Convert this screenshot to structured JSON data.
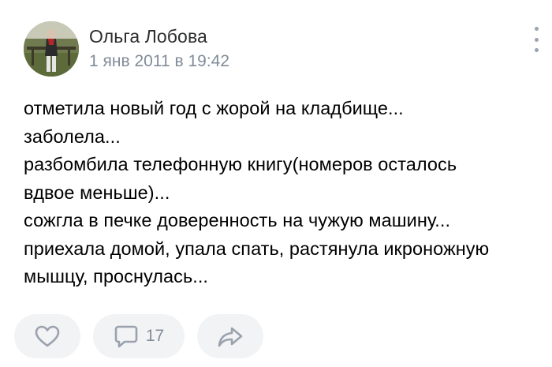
{
  "post": {
    "author": "Ольга Лобова",
    "date": "1 янв 2011 в 19:42",
    "text_lines": [
      "отметила новый год с жорой на кладбище...",
      "заболела...",
      "разбомбила телефонную книгу(номеров осталось",
      "вдвое меньше)...",
      "сожгла в печке доверенность на чужую машину...",
      "приехала домой, упала спать, растянула икроножную",
      "мышцу, проснулась..."
    ]
  },
  "actions": {
    "comments_count": "17"
  },
  "icons": {
    "more": "more-vertical-icon",
    "like": "heart-icon",
    "comment": "comment-bubble-icon",
    "share": "share-arrow-icon"
  },
  "colors": {
    "accent_icon": "#99a2ad",
    "secondary_text": "#818c99",
    "pill_background": "#f2f3f5"
  }
}
